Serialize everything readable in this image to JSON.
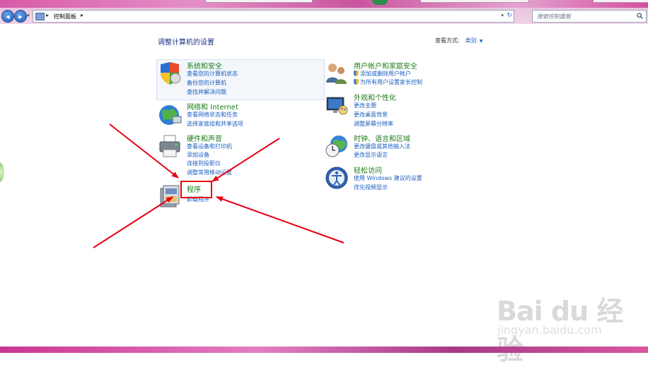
{
  "address_bar": {
    "back_glyph": "◀",
    "forward_glyph": "▶",
    "breadcrumb_sep": "▸",
    "location": "控制面板",
    "trailing_sep": "▸",
    "dropdown_glyph": "▾",
    "refresh_glyph": "↻",
    "search_placeholder": "搜索控制面板"
  },
  "header": {
    "title": "调整计算机的设置",
    "view_by_label": "查看方式:",
    "view_by_value": "类别",
    "view_by_arrow": "▼"
  },
  "categories": {
    "security": {
      "title": "系统和安全",
      "icon": "shield-icon",
      "links": [
        "查看您的计算机状态",
        "备份您的计算机",
        "查找并解决问题"
      ]
    },
    "network": {
      "title": "网络和 Internet",
      "icon": "globe-network-icon",
      "links": [
        "查看网络状态和任务",
        "选择家庭组和共享选项"
      ]
    },
    "hardware": {
      "title": "硬件和声音",
      "icon": "printer-icon",
      "links": [
        "查看设备和打印机",
        "添加设备",
        "连接到投影仪",
        "调整常用移动设置"
      ]
    },
    "programs": {
      "title": "程序",
      "icon": "programs-icon",
      "links": [
        "卸载程序"
      ]
    },
    "users": {
      "title": "用户帐户和家庭安全",
      "icon": "users-icon",
      "links": [
        "添加或删除用户帐户",
        "为所有用户设置家长控制"
      ]
    },
    "appearance": {
      "title": "外观和个性化",
      "icon": "monitor-palette-icon",
      "links": [
        "更改主题",
        "更改桌面背景",
        "调整屏幕分辨率"
      ]
    },
    "clock": {
      "title": "时钟、语言和区域",
      "icon": "clock-globe-icon",
      "links": [
        "更改键盘或其他输入法",
        "更改显示语言"
      ]
    },
    "access": {
      "title": "轻松访问",
      "icon": "ease-of-access-icon",
      "links": [
        "使用 Windows 建议的设置",
        "优化视频显示"
      ]
    }
  },
  "watermark": {
    "logo": "Bai du 经验",
    "url": "jingyan.baidu.com"
  },
  "colors": {
    "category_title": "#1b7c19",
    "link": "#1a5dbf",
    "annotation_red": "#e60012",
    "title_blue": "#1e3287"
  }
}
